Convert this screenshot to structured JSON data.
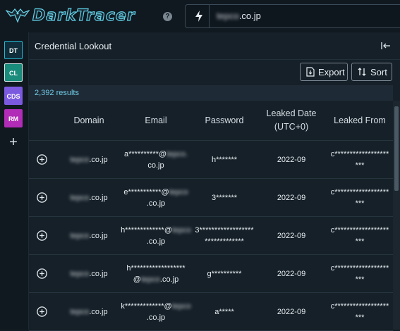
{
  "app": {
    "logo_text": "DarkTracer"
  },
  "search": {
    "value_blur": "tepco",
    "value_suffix": ".co.jp"
  },
  "sidebar": {
    "items": [
      {
        "label": "DT",
        "bg": "#0f2d3a",
        "border": "#28b8d3"
      },
      {
        "label": "CL",
        "bg": "#1a8c7c",
        "border": "#d8f0ee"
      },
      {
        "label": "CDS",
        "bg": "#7b5ae0",
        "border": "#7b5ae0"
      },
      {
        "label": "RM",
        "bg": "#b12cb7",
        "border": "#b12cb7"
      }
    ]
  },
  "panel": {
    "title": "Credential Lookout"
  },
  "toolbar": {
    "export_label": "Export",
    "sort_label": "Sort"
  },
  "results": {
    "count_text": "2,392 results"
  },
  "table": {
    "headers": {
      "domain": "Domain",
      "email": "Email",
      "password": "Password",
      "leaked_date": "Leaked Date (UTC+0)",
      "leaked_from": "Leaked From"
    },
    "rows": [
      {
        "domain_blur": "tepco",
        "domain_suffix": ".co.jp",
        "email_pre": "a**********@",
        "email_blur": "tepco.",
        "email_post": "co.jp",
        "password": "h*******",
        "date": "2022-09",
        "from": "c******************\n***"
      },
      {
        "domain_blur": "tepco",
        "domain_suffix": ".co.jp",
        "email_pre": "e***********@",
        "email_blur": "tepco",
        "email_post": ".co.jp",
        "password": "3*******",
        "date": "2022-09",
        "from": "c******************\n***"
      },
      {
        "domain_blur": "tepco",
        "domain_suffix": ".co.jp",
        "email_pre": "h*************@",
        "email_blur": "tepco",
        "email_post": ".co.jp",
        "password": "3******************\n*************",
        "date": "2022-09",
        "from": "c******************\n***"
      },
      {
        "domain_blur": "tepco",
        "domain_suffix": ".co.jp",
        "email_pre": "h******************\n@",
        "email_blur": "tepco",
        "email_post": ".co.jp",
        "password": "g**********",
        "date": "2022-09",
        "from": "c******************\n***"
      },
      {
        "domain_blur": "tepco",
        "domain_suffix": ".co.jp",
        "email_pre": "k*************@",
        "email_blur": "tepco",
        "email_post": ".co.jp",
        "password": "a*****",
        "date": "2022-09",
        "from": "c******************\n***"
      }
    ]
  }
}
